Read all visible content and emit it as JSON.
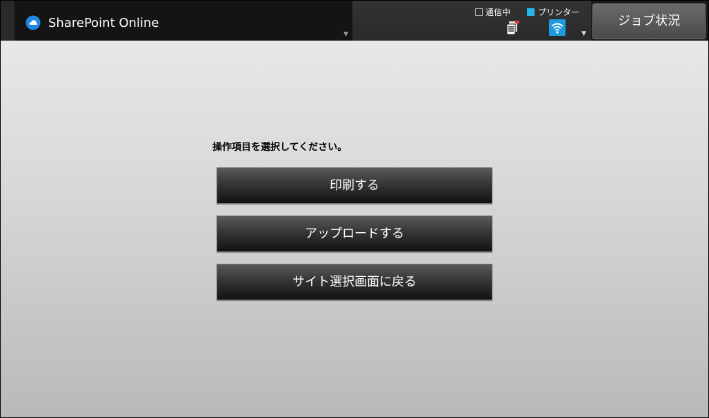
{
  "header": {
    "app_title": "SharePoint Online",
    "app_icon": "cloud-icon",
    "status": {
      "communicating_label": "通信中",
      "printer_label": "プリンター",
      "printer_color": "#22b7e8"
    },
    "job_status_label": "ジョブ状況"
  },
  "main": {
    "prompt": "操作項目を選択してください。",
    "actions": [
      {
        "label": "印刷する"
      },
      {
        "label": "アップロードする"
      },
      {
        "label": "サイト選択画面に戻る"
      }
    ]
  }
}
